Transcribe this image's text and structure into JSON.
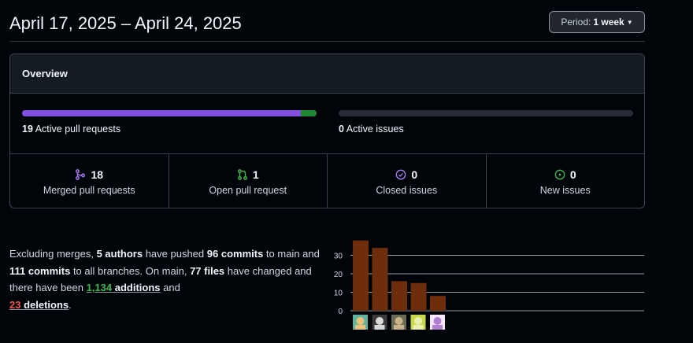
{
  "header": {
    "date_range": "April 17, 2025 – April 24, 2025",
    "period_label": "Period:",
    "period_value": "1 week"
  },
  "overview": {
    "title": "Overview",
    "pull_requests": {
      "count": "19",
      "label": "Active pull requests",
      "merged_fraction": 0.947,
      "open_fraction": 0.053
    },
    "issues": {
      "count": "0",
      "label": "Active issues"
    },
    "stats": [
      {
        "name": "merged",
        "count": "18",
        "label": "Merged pull requests",
        "icon": "git-merge-icon",
        "color": "#ab7df8"
      },
      {
        "name": "open",
        "count": "1",
        "label": "Open pull request",
        "icon": "git-pull-request-icon",
        "color": "#3fb950"
      },
      {
        "name": "closed",
        "count": "0",
        "label": "Closed issues",
        "icon": "issue-closed-icon",
        "color": "#ab7df8"
      },
      {
        "name": "new",
        "count": "0",
        "label": "New issues",
        "icon": "issue-opened-icon",
        "color": "#3fb950"
      }
    ]
  },
  "summary": {
    "t1": "Excluding merges, ",
    "authors": "5 authors",
    "t2": " have pushed ",
    "commits_main": "96 commits",
    "t3": " to main and ",
    "commits_all": "111 commits",
    "t4": " to all branches. On main, ",
    "files": "77 files",
    "t5": " have changed and there have been ",
    "additions_num": "1,134",
    "additions_word": " additions",
    "t6": " and ",
    "deletions_num": "23",
    "deletions_word": " deletions",
    "t7": "."
  },
  "chart_data": {
    "type": "bar",
    "categories": [
      "author-1",
      "author-2",
      "author-3",
      "author-4",
      "author-5"
    ],
    "values": [
      38,
      34,
      16,
      15,
      8
    ],
    "ylim": [
      0,
      30
    ],
    "yticks": [
      "0",
      "10",
      "20",
      "30"
    ],
    "bar_color": "#6e2d0b",
    "grid": true,
    "avatars": [
      {
        "bg": "#5fb3a0",
        "fg": "#e8c27a"
      },
      {
        "bg": "#3a3a3a",
        "fg": "#d9d9d9"
      },
      {
        "bg": "#6b6b55",
        "fg": "#c9b48a"
      },
      {
        "bg": "#c8d648",
        "fg": "#e9f0b0"
      },
      {
        "bg": "#f4e8f8",
        "fg": "#b07fd0"
      }
    ]
  }
}
